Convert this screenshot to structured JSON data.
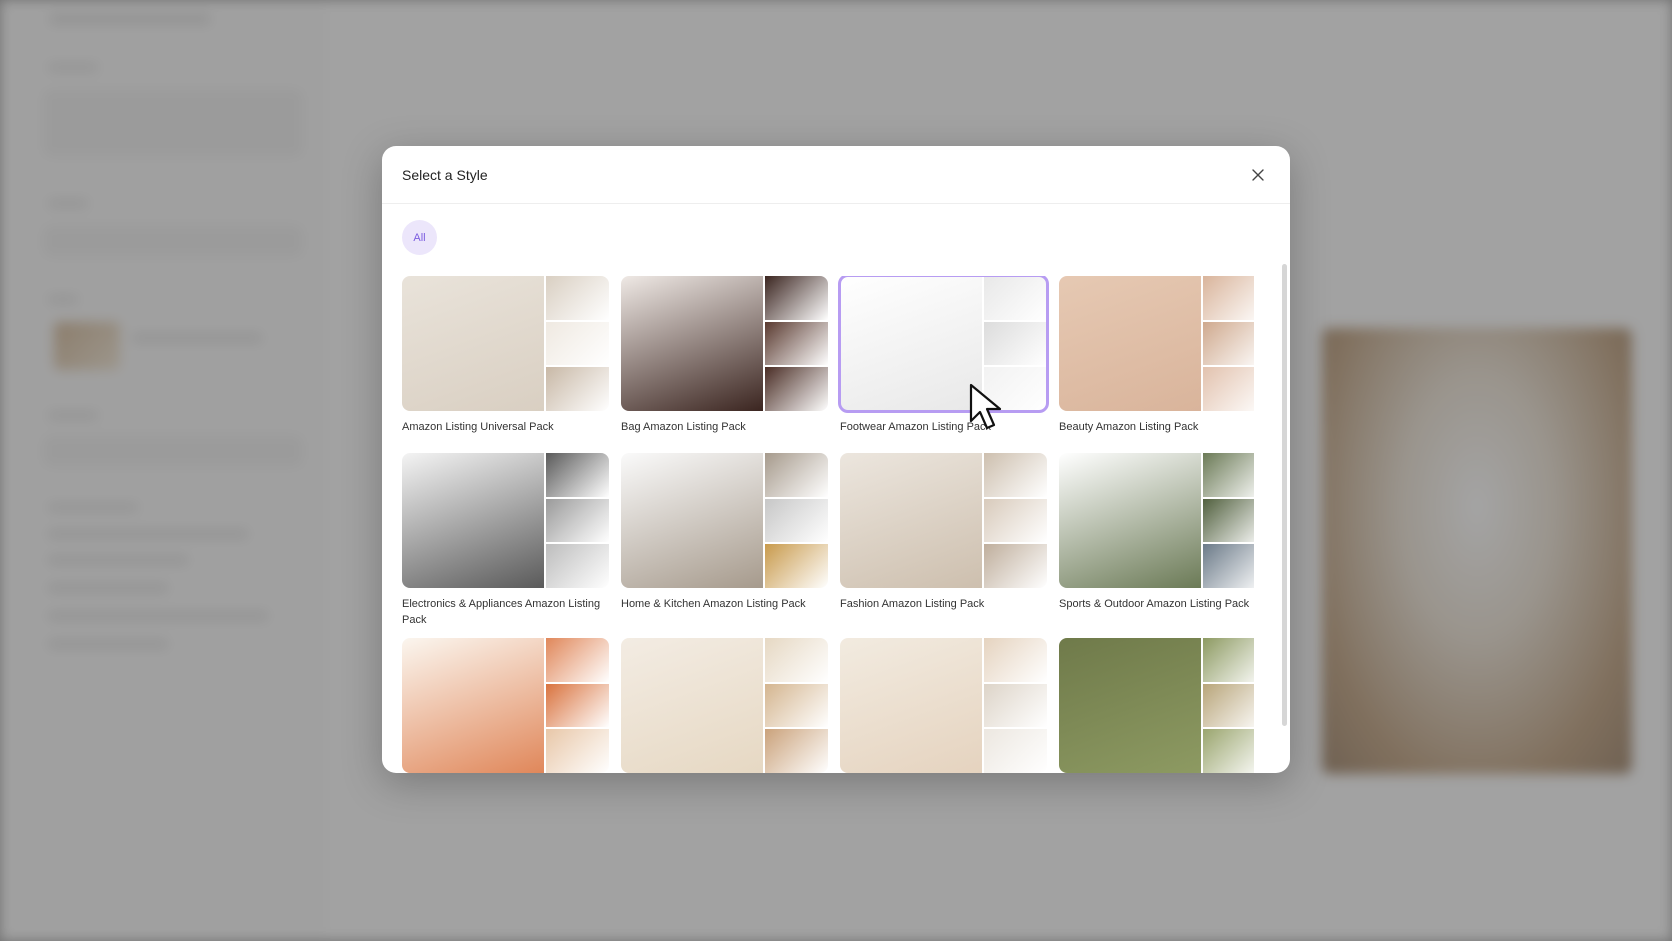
{
  "modal": {
    "title": "Select a Style",
    "close_icon": "close-icon",
    "filters": [
      {
        "label": "All",
        "active": true
      }
    ],
    "accent_color": "#7b5ce0"
  },
  "styles": [
    {
      "label": "Amazon Listing Universal Pack",
      "selected": false
    },
    {
      "label": "Bag Amazon Listing Pack",
      "selected": false
    },
    {
      "label": "Footwear Amazon Listing Pack",
      "selected": true
    },
    {
      "label": "Beauty Amazon Listing Pack",
      "selected": false
    },
    {
      "label": "Electronics & Appliances Amazon Listing Pack",
      "selected": false
    },
    {
      "label": "Home & Kitchen Amazon Listing Pack",
      "selected": false
    },
    {
      "label": "Fashion Amazon Listing Pack",
      "selected": false
    },
    {
      "label": "Sports & Outdoor Amazon Listing Pack",
      "selected": false
    },
    {
      "label": "",
      "selected": false
    },
    {
      "label": "",
      "selected": false
    },
    {
      "label": "",
      "selected": false
    },
    {
      "label": "",
      "selected": false
    }
  ],
  "thumb_colors": [
    [
      "#e9e3da",
      "#d9cfc2",
      "#efe9e1",
      "#c8b8a6"
    ],
    [
      "#efe9e5",
      "#3b2520",
      "#5a3a30",
      "#4a2d25"
    ],
    [
      "#ffffff",
      "#e8e8e8",
      "#dcdcdc",
      "#f2f2f2"
    ],
    [
      "#e6c9b3",
      "#d9b49b",
      "#cfa98e",
      "#e2c2ae"
    ],
    [
      "#f4f4f4",
      "#5a5a5a",
      "#9a9a9a",
      "#bdbdbd"
    ],
    [
      "#fafafa",
      "#a69a8c",
      "#c7c7c7",
      "#c89a4c"
    ],
    [
      "#ece6de",
      "#cdbfae",
      "#d8cabb",
      "#bfae9c"
    ],
    [
      "#ffffff",
      "#6b7a56",
      "#51603e",
      "#6b7a88"
    ],
    [
      "#fbf6ef",
      "#e0875a",
      "#d9733f",
      "#e8c7a8"
    ],
    [
      "#f3ece3",
      "#e6d8c3",
      "#d4b58f",
      "#caa27b"
    ],
    [
      "#f2ebe0",
      "#e5d3bf",
      "#ddd4c8",
      "#ece7e0"
    ],
    [
      "#6f7a4a",
      "#8d9a62",
      "#b8a57a",
      "#9aa56e"
    ]
  ]
}
